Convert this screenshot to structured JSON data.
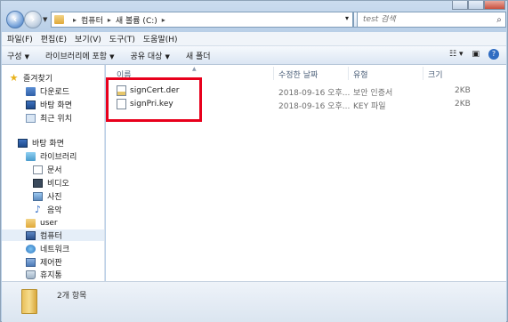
{
  "window": {
    "controls": [
      "minimize",
      "maximize",
      "close"
    ]
  },
  "address": {
    "crumbs": [
      "컴퓨터",
      "새 볼륨 (C:)"
    ],
    "search_placeholder": "test 검색"
  },
  "menubar": {
    "items": [
      "파일(F)",
      "편집(E)",
      "보기(V)",
      "도구(T)",
      "도움말(H)"
    ]
  },
  "toolbar": {
    "organize": "구성",
    "include_library": "라이브러리에 포함",
    "share": "공유 대상",
    "new_folder": "새 폴더"
  },
  "navpane": {
    "favorites": "즐겨찾기",
    "downloads": "다운로드",
    "desktop_fav": "바탕 화면",
    "recent": "최근 위치",
    "desktop": "바탕 화면",
    "libraries": "라이브러리",
    "documents": "문서",
    "videos": "비디오",
    "pictures": "사진",
    "music": "음악",
    "user": "user",
    "computer": "컴퓨터",
    "network": "네트워크",
    "control_panel": "제어판",
    "recycle_bin": "휴지통"
  },
  "columns": {
    "name": "이름",
    "date": "수정한 날짜",
    "type": "유형",
    "size": "크기"
  },
  "files": [
    {
      "name": "signCert.der",
      "date": "2018-09-16 오후...",
      "type": "보안 인증서",
      "size": "2KB"
    },
    {
      "name": "signPri.key",
      "date": "2018-09-16 오후...",
      "type": "KEY 파일",
      "size": "2KB"
    }
  ],
  "status": {
    "count": "2개 항목"
  },
  "colors": {
    "highlight": "#e8001c",
    "selection": "#e5eef8"
  }
}
